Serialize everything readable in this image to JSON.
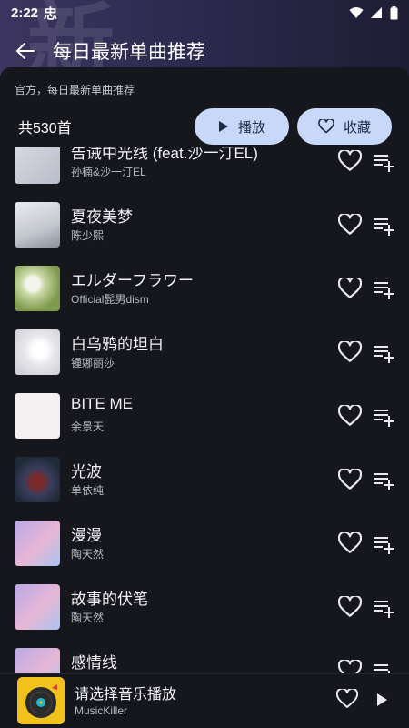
{
  "status": {
    "time": "2:22",
    "app_glyph": "忠"
  },
  "hero": {
    "watermark": "新"
  },
  "header": {
    "title": "每日最新单曲推荐"
  },
  "playlist": {
    "description": "官方，每日最新单曲推荐",
    "count": "共530首",
    "play_label": "播放",
    "favorite_label": "收藏"
  },
  "songs": [
    {
      "title": "告诫中光线 (feat.沙一汀EL)",
      "artist": "孙楠&沙一汀EL"
    },
    {
      "title": "夏夜美梦",
      "artist": "陈少熙"
    },
    {
      "title": "エルダーフラワー",
      "artist": "Official髭男dism"
    },
    {
      "title": "白乌鸦的坦白",
      "artist": "锺娜丽莎"
    },
    {
      "title": "BITE ME",
      "artist": "余景天"
    },
    {
      "title": "光波",
      "artist": "单依纯"
    },
    {
      "title": "漫漫",
      "artist": "陶天然"
    },
    {
      "title": "故事的伏笔",
      "artist": "陶天然"
    },
    {
      "title": "感情线",
      "artist": ""
    }
  ],
  "player": {
    "title": "请选择音乐播放",
    "subtitle": "MusicKiller"
  },
  "icons": {
    "back": "arrow-left-icon",
    "play": "play-icon",
    "heart": "heart-outline-icon",
    "queue": "playlist-add-icon"
  },
  "colors": {
    "accent": "#c8d8f8",
    "background": "#15171d",
    "player_cover": "#f1c21b"
  }
}
